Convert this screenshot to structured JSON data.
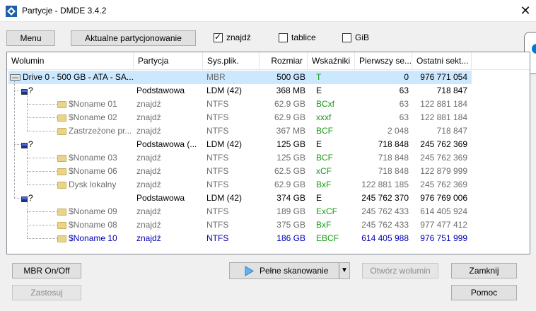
{
  "window": {
    "title": "Partycje - DMDE 3.4.2",
    "close_glyph": "✕",
    "icon": "dmde-app-icon"
  },
  "toolbar": {
    "menu_label": "Menu",
    "current_partitioning_label": "Aktualne partycjonowanie",
    "find_checkbox": {
      "label": "znajdź",
      "checked": true
    },
    "tables_checkbox": {
      "label": "tablice",
      "checked": false
    },
    "gib_checkbox": {
      "label": "GiB",
      "checked": false
    }
  },
  "table": {
    "columns": [
      "Wolumin",
      "Partycja",
      "Sys.plik.",
      "Rozmiar",
      "Wskaźniki",
      "Pierwszy se...",
      "Ostatni sekt..."
    ],
    "rows": [
      {
        "kind": "drive",
        "name": "Drive 0 - 500 GB - ATA - SA...",
        "partition": "",
        "fs": "MBR",
        "size": "500 GB",
        "flags": "T",
        "first": "0",
        "last": "976 771 054",
        "selected": true
      },
      {
        "kind": "group",
        "name": "?",
        "partition": "Podstawowa",
        "fs": "LDM (42)",
        "size": "368 MB",
        "flags": "E",
        "first": "63",
        "last": "718 847"
      },
      {
        "kind": "volume",
        "name": "$Noname 01",
        "partition": "znajdź",
        "fs": "NTFS",
        "size": "62.9 GB",
        "flags": "BCxf",
        "first": "63",
        "last": "122 881 184"
      },
      {
        "kind": "volume",
        "name": "$Noname 02",
        "partition": "znajdź",
        "fs": "NTFS",
        "size": "62.9 GB",
        "flags": "xxxf",
        "first": "63",
        "last": "122 881 184"
      },
      {
        "kind": "volume",
        "name": "Zastrzeżone pr...",
        "partition": "znajdź",
        "fs": "NTFS",
        "size": "367 MB",
        "flags": "BCF",
        "first": "2 048",
        "last": "718 847"
      },
      {
        "kind": "group",
        "name": "?",
        "partition": "Podstawowa (...",
        "fs": "LDM (42)",
        "size": "125 GB",
        "flags": "E",
        "first": "718 848",
        "last": "245 762 369"
      },
      {
        "kind": "volume",
        "name": "$Noname 03",
        "partition": "znajdź",
        "fs": "NTFS",
        "size": "125 GB",
        "flags": "BCF",
        "first": "718 848",
        "last": "245 762 369"
      },
      {
        "kind": "volume",
        "name": "$Noname 06",
        "partition": "znajdź",
        "fs": "NTFS",
        "size": "62.5 GB",
        "flags": "xCF",
        "first": "718 848",
        "last": "122 879 999"
      },
      {
        "kind": "volume",
        "name": "Dysk lokalny",
        "partition": "znajdź",
        "fs": "NTFS",
        "size": "62.9 GB",
        "flags": "BxF",
        "first": "122 881 185",
        "last": "245 762 369"
      },
      {
        "kind": "group",
        "name": "?",
        "partition": "Podstawowa",
        "fs": "LDM (42)",
        "size": "374 GB",
        "flags": "E",
        "first": "245 762 370",
        "last": "976 769 006"
      },
      {
        "kind": "volume",
        "name": "$Noname 09",
        "partition": "znajdź",
        "fs": "NTFS",
        "size": "189 GB",
        "flags": "ExCF",
        "first": "245 762 433",
        "last": "614 405 924"
      },
      {
        "kind": "volume",
        "name": "$Noname 08",
        "partition": "znajdź",
        "fs": "NTFS",
        "size": "375 GB",
        "flags": "BxF",
        "first": "245 762 433",
        "last": "977 477 412"
      },
      {
        "kind": "volume",
        "name": "$Noname 10",
        "partition": "znajdź",
        "fs": "NTFS",
        "size": "186 GB",
        "flags": "EBCF",
        "first": "614 405 988",
        "last": "976 751 999",
        "highlight": true
      }
    ]
  },
  "buttons": {
    "mbr_toggle": "MBR On/Off",
    "apply": "Zastosuj",
    "full_scan": "Pełne skanowanie",
    "open_volume": "Otwórz wolumin",
    "close": "Zamknij",
    "help": "Pomoc"
  },
  "colors": {
    "selection": "#cce8ff",
    "flags_green": "#1a9a1a",
    "highlight_blue": "#0000b4",
    "gray_text": "#6d6d6d"
  }
}
